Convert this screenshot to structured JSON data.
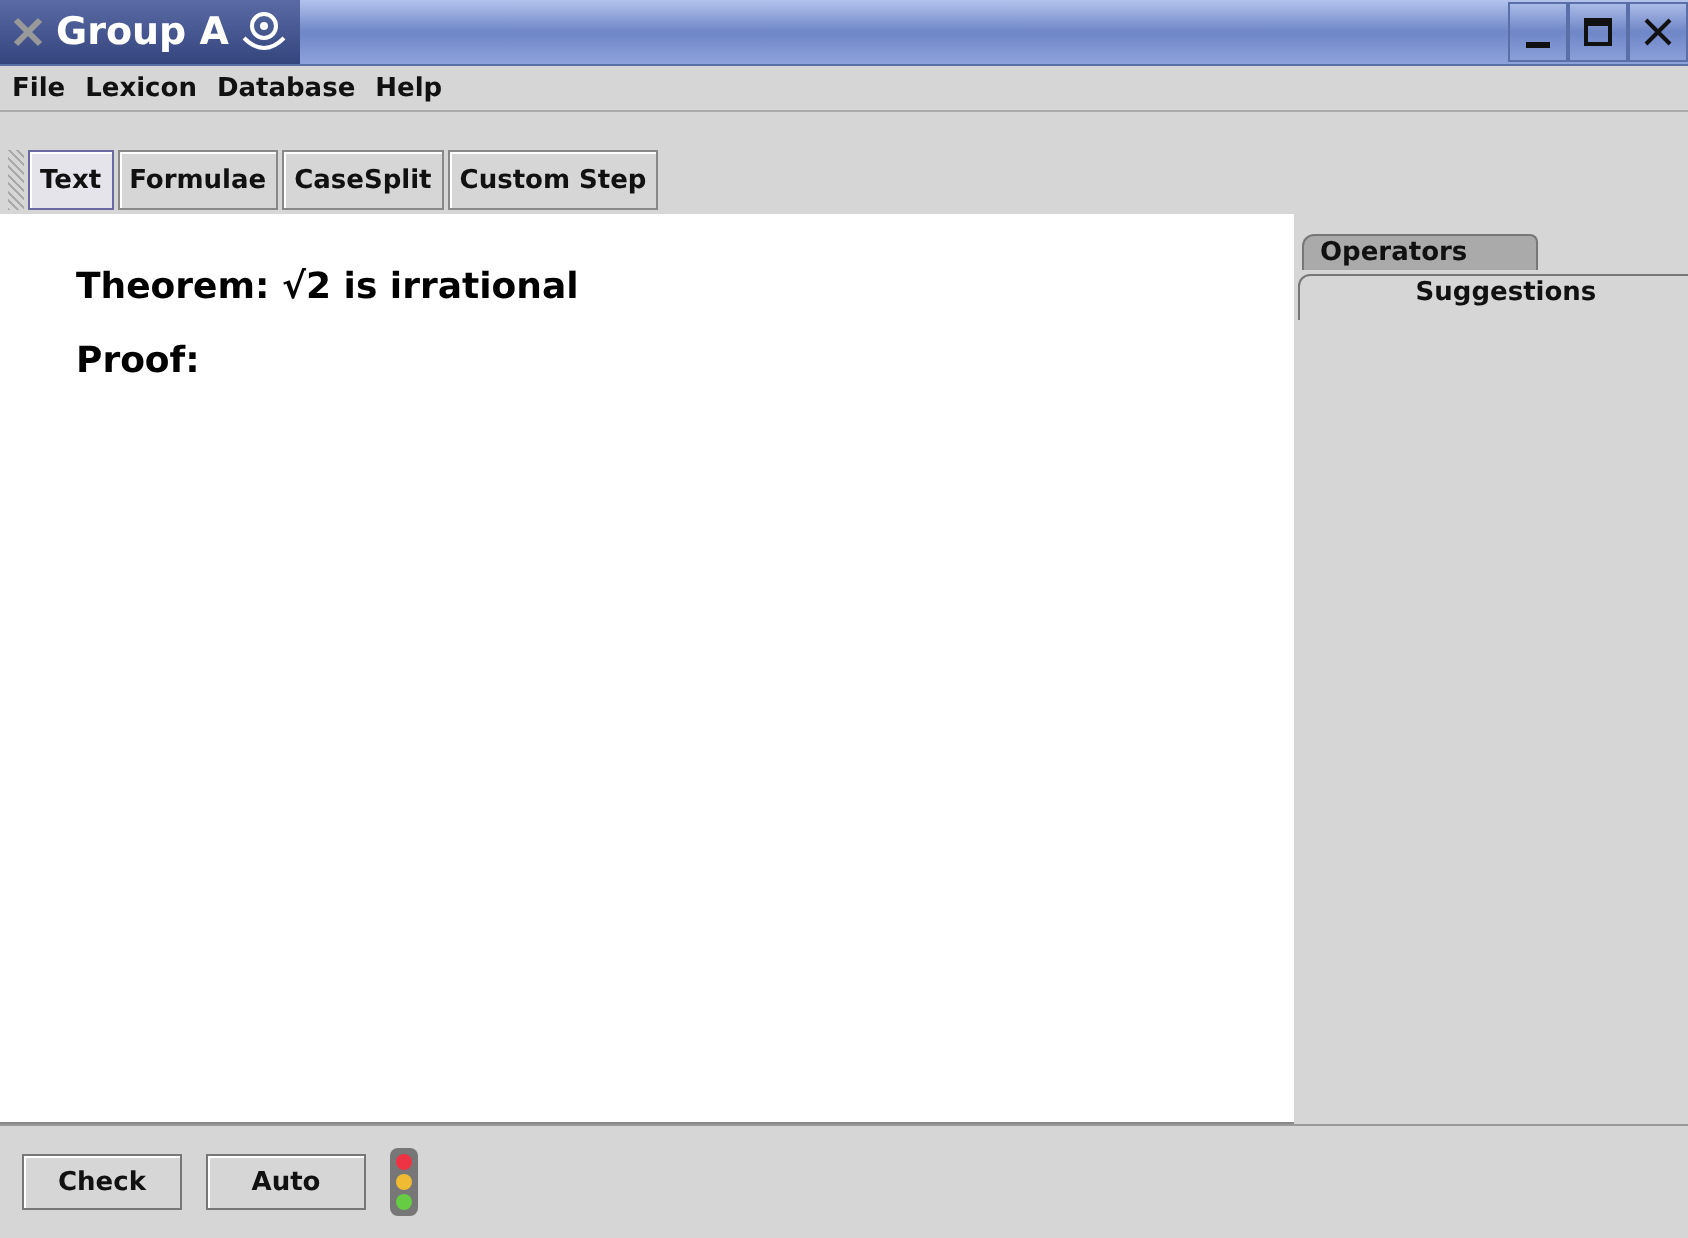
{
  "window": {
    "title": "Group A"
  },
  "menu": [
    "File",
    "Lexicon",
    "Database",
    "Help"
  ],
  "toolbar": [
    {
      "label": "Text",
      "selected": true
    },
    {
      "label": "Formulae",
      "selected": false
    },
    {
      "label": "CaseSplit",
      "selected": false
    },
    {
      "label": "Custom Step",
      "selected": false
    }
  ],
  "document": {
    "lines": [
      "Theorem: √2 is irrational",
      "Proof:"
    ]
  },
  "side_tabs": [
    {
      "label": "Operators",
      "selected": false
    },
    {
      "label": "Suggestions",
      "selected": true
    }
  ],
  "buttons": [
    "Check",
    "Auto"
  ]
}
